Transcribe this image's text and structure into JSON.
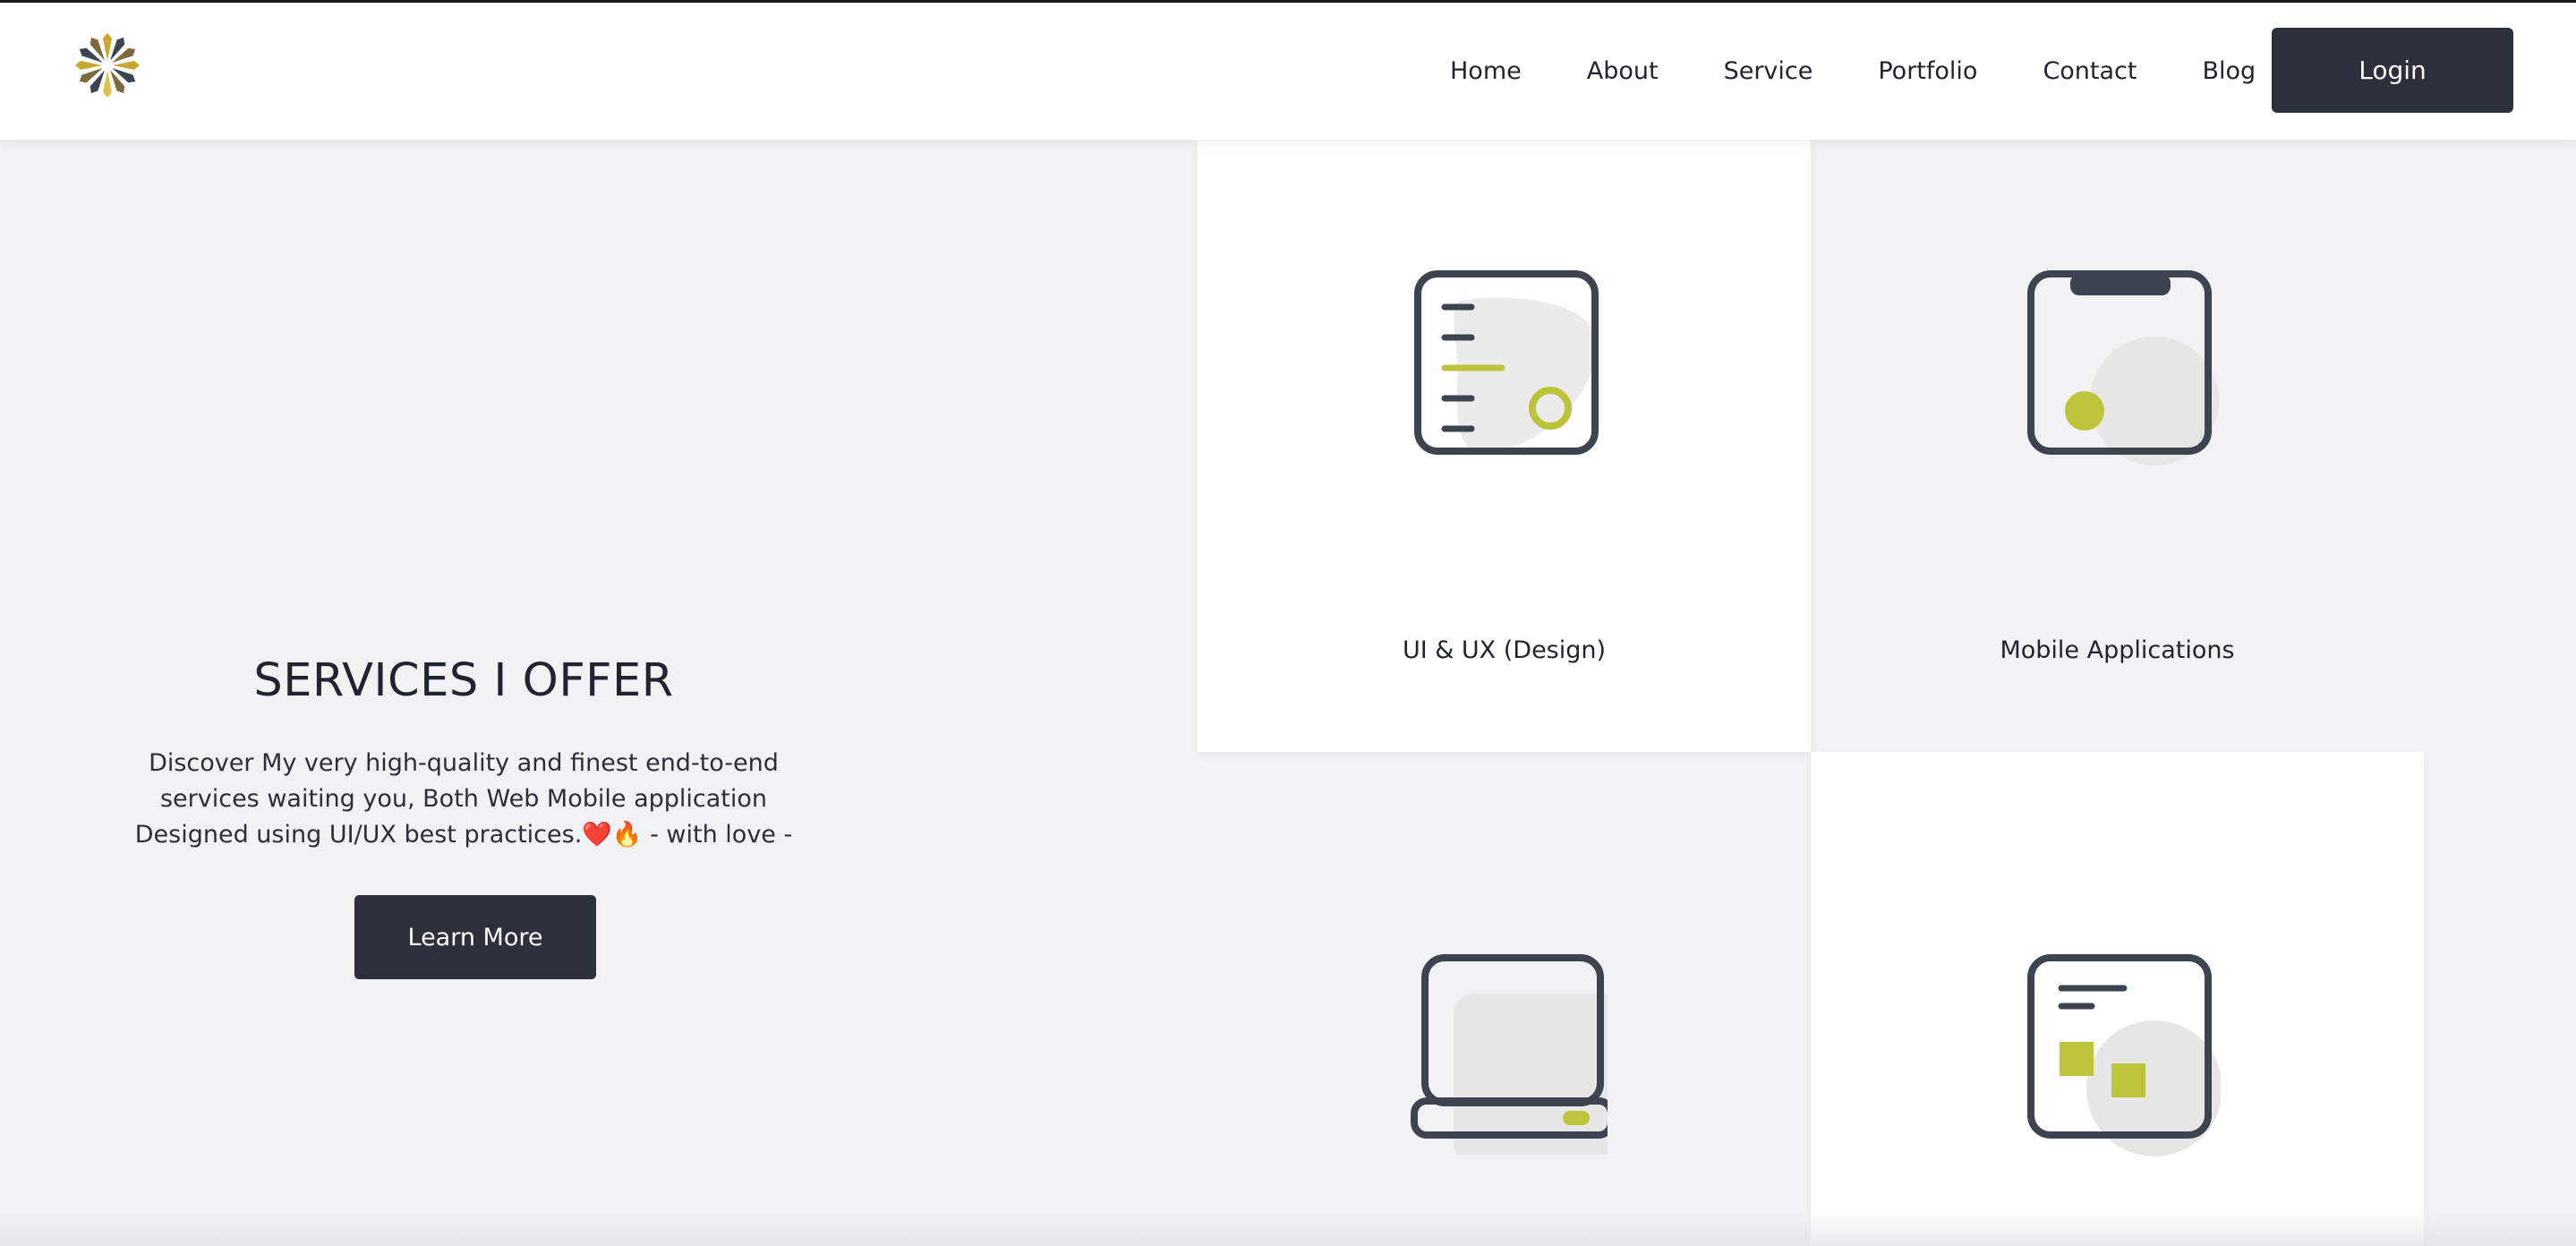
{
  "header": {
    "logo_icon": "sunburst-logo-icon",
    "nav": [
      {
        "label": "Home"
      },
      {
        "label": "About"
      },
      {
        "label": "Service"
      },
      {
        "label": "Portfolio"
      },
      {
        "label": "Contact"
      },
      {
        "label": "Blog"
      }
    ],
    "login_label": "Login"
  },
  "hero": {
    "title": "SERVICES I OFFER",
    "description": "Discover My very high-quality and finest end-to-end services waiting you, Both Web Mobile application Designed using UI/UX best practices.❤️🔥 - with love -",
    "button_label": "Learn More"
  },
  "services": [
    {
      "label": "UI & UX (Design)",
      "icon": "ui-ux-design-icon"
    },
    {
      "label": "Mobile Applications",
      "icon": "mobile-phone-icon"
    },
    {
      "label": "",
      "icon": "laptop-icon"
    },
    {
      "label": "",
      "icon": "dashboard-tablet-icon"
    }
  ],
  "colors": {
    "accent": "#bcc43c",
    "dark": "#2b303b",
    "icon_stroke": "#3d4450",
    "blob": "#ebebeb",
    "background": "#f1f2f4"
  }
}
